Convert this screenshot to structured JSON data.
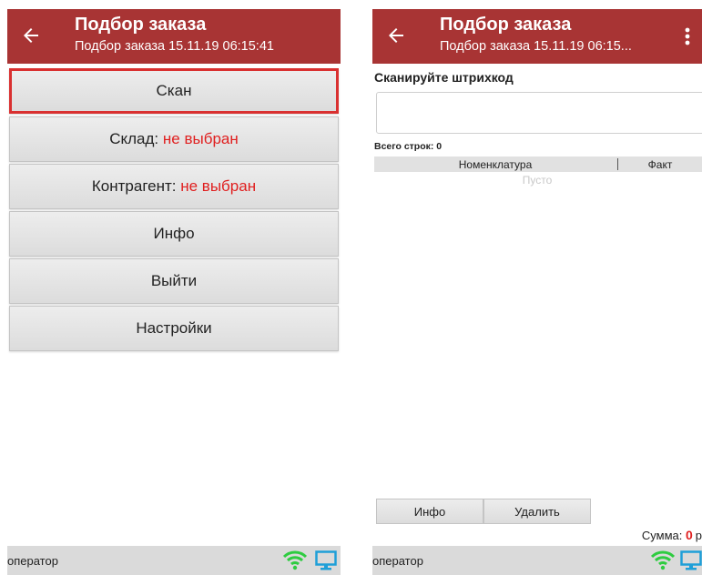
{
  "left_screen": {
    "appbar": {
      "title": "Подбор заказа",
      "subtitle": "Подбор заказа 15.11.19 06:15:41"
    },
    "buttons": {
      "scan": "Скан",
      "warehouse_label": "Склад: ",
      "warehouse_value": "не выбран",
      "counterparty_label": "Контрагент: ",
      "counterparty_value": "не выбран",
      "info": "Инфо",
      "exit": "Выйти",
      "settings": "Настройки"
    },
    "statusbar": {
      "user": "оператор"
    }
  },
  "right_screen": {
    "appbar": {
      "title": "Подбор заказа",
      "subtitle": "Подбор заказа 15.11.19 06:15..."
    },
    "scan_prompt": "Сканируйте штрихкод",
    "scan_input_value": "",
    "rows_count": "Всего строк: 0",
    "table": {
      "columns": [
        "Номенклатура",
        "Факт"
      ],
      "empty_text": "Пусто",
      "rows": []
    },
    "buttons": {
      "info": "Инфо",
      "delete": "Удалить"
    },
    "sum": {
      "label": "Сумма: ",
      "value": "0",
      "unit": "р"
    },
    "statusbar": {
      "user": "оператор"
    }
  },
  "icons": {
    "back": "arrow-left-icon",
    "menu": "more-vertical-icon",
    "wifi": "wifi-icon",
    "monitor": "monitor-icon"
  },
  "colors": {
    "appbar": "#a83434",
    "accent_red": "#e01f1f",
    "active_border": "#d93030",
    "wifi_green": "#2ecc40",
    "monitor_blue": "#1f9fd8"
  }
}
